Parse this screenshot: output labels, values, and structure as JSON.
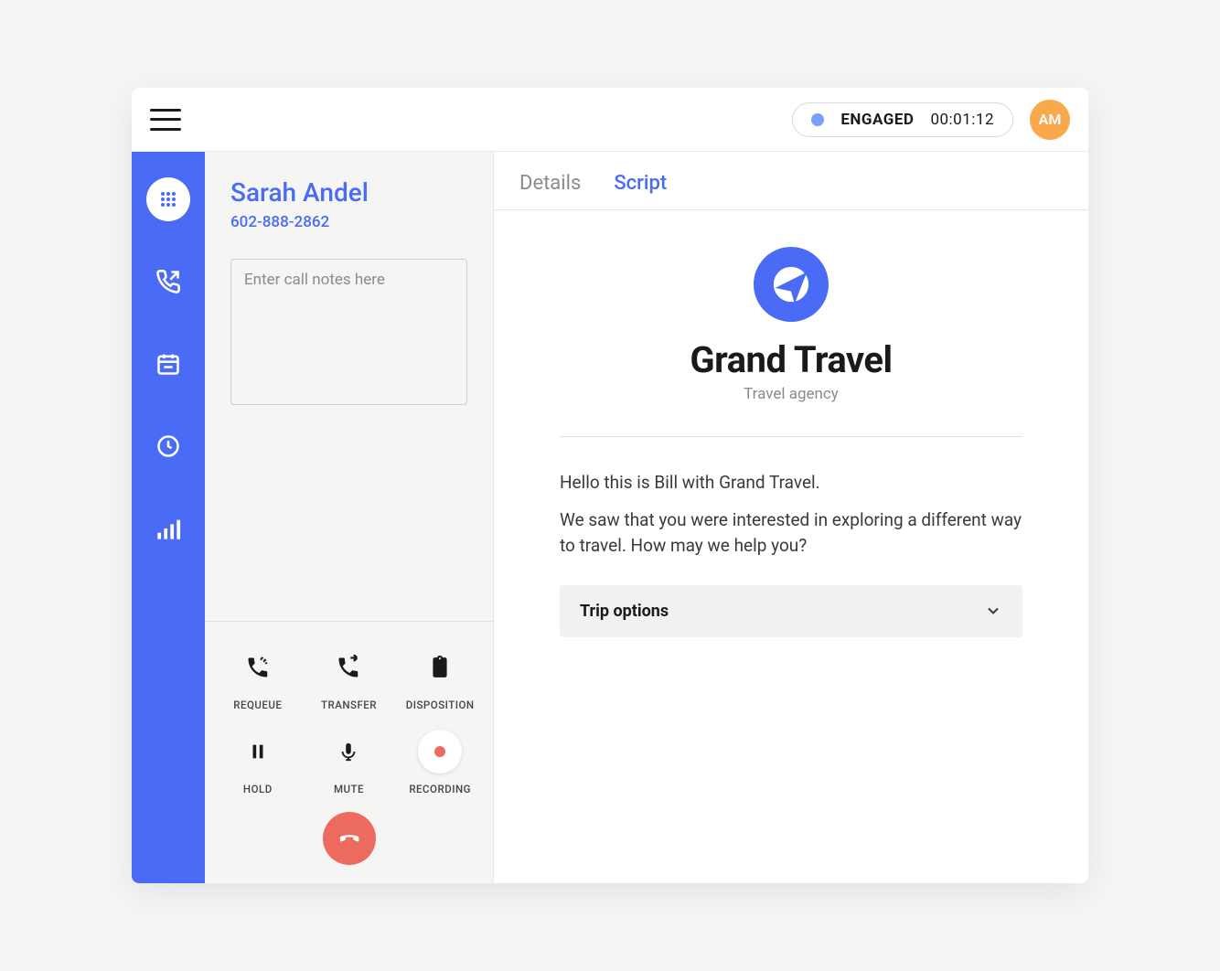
{
  "header": {
    "status_label": "ENGAGED",
    "timer": "00:01:12",
    "avatar_initials": "AM"
  },
  "caller": {
    "name": "Sarah Andel",
    "phone": "602-888-2862",
    "notes_placeholder": "Enter call notes here"
  },
  "controls": {
    "requeue": "REQUEUE",
    "transfer": "TRANSFER",
    "disposition": "DISPOSITION",
    "hold": "HOLD",
    "mute": "MUTE",
    "recording": "RECORDING"
  },
  "tabs": {
    "details": "Details",
    "script": "Script",
    "active": "script"
  },
  "org": {
    "name": "Grand Travel",
    "subtitle": "Travel agency"
  },
  "script": {
    "line1": "Hello this is Bill with Grand Travel.",
    "line2": "We saw that you were interested in exploring a different way to travel. How may we help you?"
  },
  "accordion": {
    "title": "Trip options"
  },
  "colors": {
    "primary": "#4a6bf5",
    "avatar": "#f7a94b",
    "danger": "#ed6a5e"
  }
}
